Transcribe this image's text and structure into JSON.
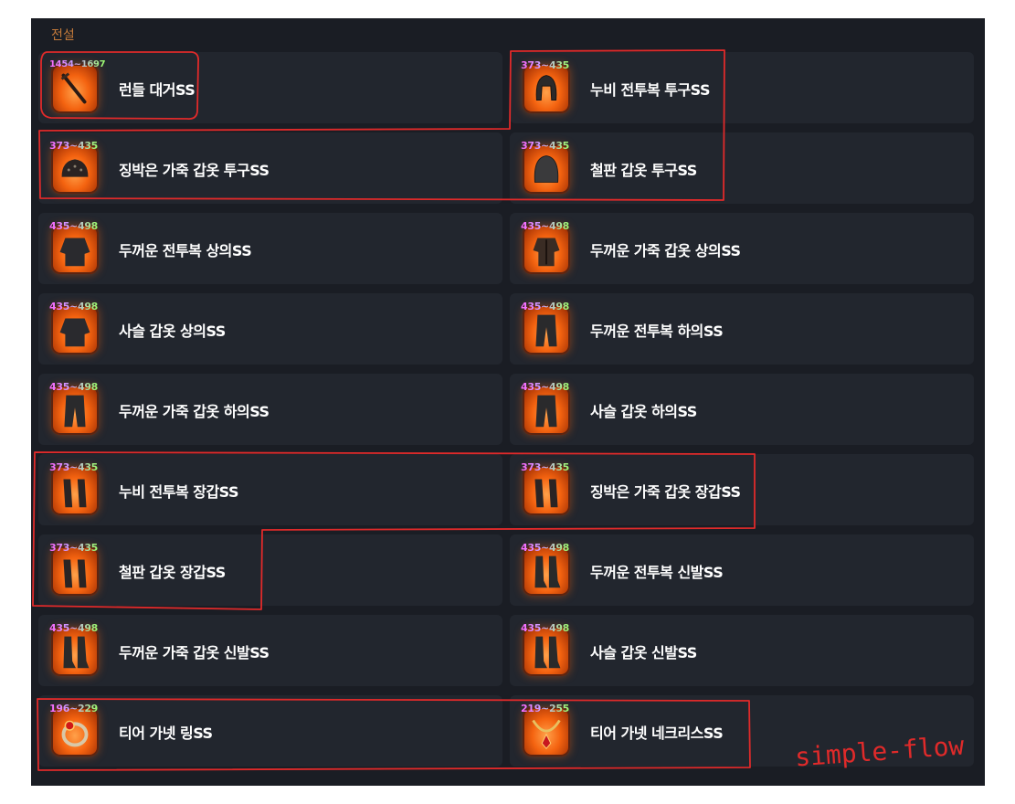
{
  "section": {
    "title": "전설"
  },
  "rows": [
    [
      {
        "name": "런들 대거SS",
        "range": "1454~1697",
        "icon": "dagger-icon"
      },
      {
        "name": "누비 전투복 투구SS",
        "range": "373~435",
        "icon": "helmet-icon"
      }
    ],
    [
      {
        "name": "징박은 가죽 갑옷 투구SS",
        "range": "373~435",
        "icon": "leather-cap-icon"
      },
      {
        "name": "철판 갑옷 투구SS",
        "range": "373~435",
        "icon": "plate-helmet-icon"
      }
    ],
    [
      {
        "name": "두꺼운 전투복 상의SS",
        "range": "435~498",
        "icon": "tunic-icon"
      },
      {
        "name": "두꺼운 가죽 갑옷 상의SS",
        "range": "435~498",
        "icon": "leather-armor-icon"
      }
    ],
    [
      {
        "name": "사슬 갑옷 상의SS",
        "range": "435~498",
        "icon": "chain-armor-icon"
      },
      {
        "name": "두꺼운 전투복 하의SS",
        "range": "435~498",
        "icon": "pants-icon"
      }
    ],
    [
      {
        "name": "두꺼운 가죽 갑옷 하의SS",
        "range": "435~498",
        "icon": "leather-pants-icon"
      },
      {
        "name": "사슬 갑옷 하의SS",
        "range": "435~498",
        "icon": "chain-pants-icon"
      }
    ],
    [
      {
        "name": "누비 전투복 장갑SS",
        "range": "373~435",
        "icon": "gloves-icon"
      },
      {
        "name": "징박은 가죽 갑옷 장갑SS",
        "range": "373~435",
        "icon": "studded-gloves-icon"
      }
    ],
    [
      {
        "name": "철판 갑옷 장갑SS",
        "range": "373~435",
        "icon": "plate-gloves-icon"
      },
      {
        "name": "두꺼운 전투복 신발SS",
        "range": "435~498",
        "icon": "boots-icon"
      }
    ],
    [
      {
        "name": "두꺼운 가죽 갑옷 신발SS",
        "range": "435~498",
        "icon": "leather-boots-icon"
      },
      {
        "name": "사슬 갑옷 신발SS",
        "range": "435~498",
        "icon": "chain-boots-icon"
      }
    ],
    [
      {
        "name": "티어 가넷 링SS",
        "range": "196~229",
        "icon": "ring-icon"
      },
      {
        "name": "티어 가넷 네크리스SS",
        "range": "219~255",
        "icon": "necklace-icon"
      }
    ]
  ],
  "annotation": {
    "label": "simple-flow",
    "color": "#e02a2a"
  }
}
